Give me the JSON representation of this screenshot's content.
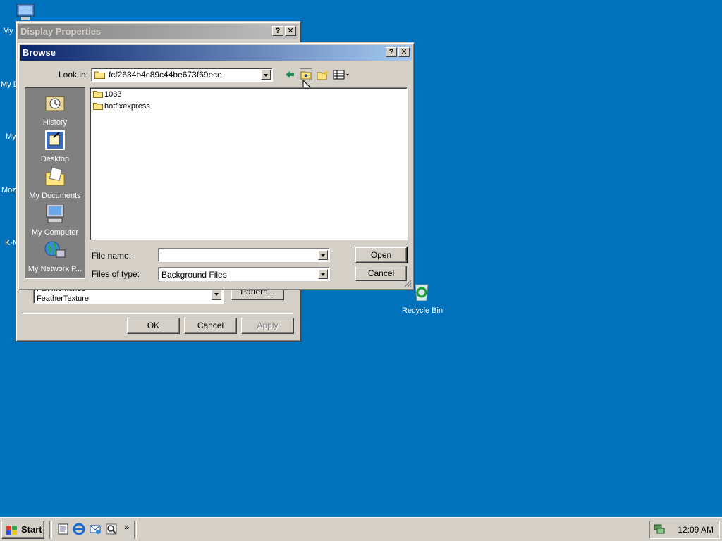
{
  "desktop": {
    "icons": [
      {
        "name": "my-computer-desktop",
        "label": "My"
      },
      {
        "name": "my-documents-desktop",
        "label": "My D"
      },
      {
        "name": "my-network-desktop",
        "label": "My"
      },
      {
        "name": "mozilla-desktop",
        "label": "Moz"
      },
      {
        "name": "kmeleon-desktop",
        "label": "K-M"
      },
      {
        "name": "recycle-bin",
        "label": "Recycle Bin"
      }
    ]
  },
  "display_properties": {
    "title": "Display Properties",
    "list_items": [
      "Fall Memories",
      "FeatherTexture"
    ],
    "pattern_label": "Pattern...",
    "ok_label": "OK",
    "cancel_label": "Cancel",
    "apply_label": "Apply"
  },
  "browse": {
    "title": "Browse",
    "look_in_label": "Look in:",
    "look_in_value": "fcf2634b4c89c44be673f69ece",
    "places": [
      "History",
      "Desktop",
      "My Documents",
      "My Computer",
      "My Network P..."
    ],
    "files": [
      "1033",
      "hotfixexpress"
    ],
    "file_name_label": "File name:",
    "file_name_value": "",
    "files_of_type_label": "Files of type:",
    "files_of_type_value": "Background Files",
    "open_label": "Open",
    "cancel_label": "Cancel"
  },
  "taskbar": {
    "start_label": "Start",
    "clock": "12:09 AM"
  }
}
